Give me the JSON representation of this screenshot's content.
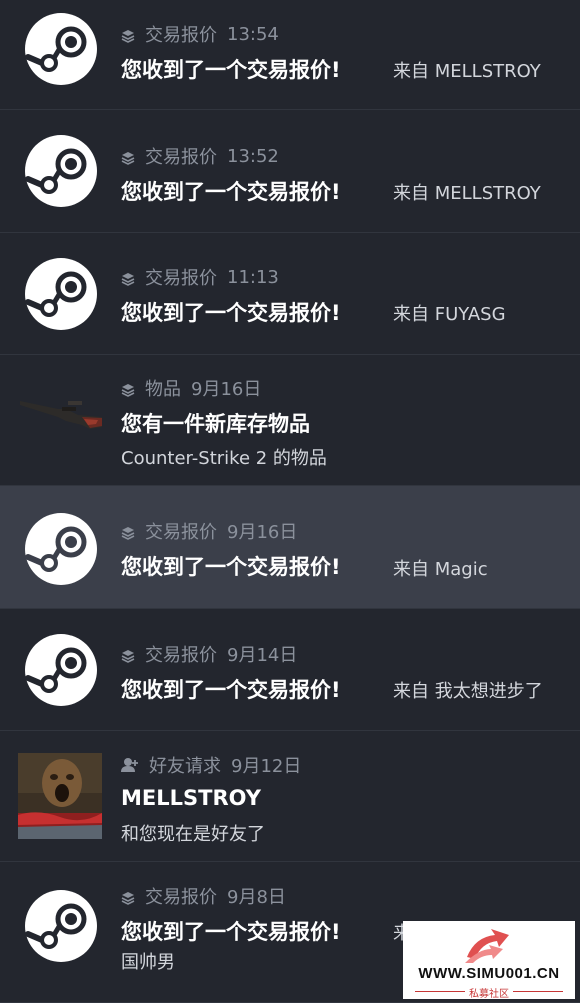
{
  "notifications": [
    {
      "type": "trade",
      "category": "交易报价",
      "time": "13:54",
      "title": "您收到了一个交易报价!",
      "from_prefix": "来自",
      "from_name": "MELLSTROY"
    },
    {
      "type": "trade",
      "category": "交易报价",
      "time": "13:52",
      "title": "您收到了一个交易报价!",
      "from_prefix": "来自",
      "from_name": "MELLSTROY"
    },
    {
      "type": "trade",
      "category": "交易报价",
      "time": "11:13",
      "title": "您收到了一个交易报价!",
      "from_prefix": "来自",
      "from_name": "FUYASG"
    },
    {
      "type": "item",
      "category": "物品",
      "time": "9月16日",
      "title": "您有一件新库存物品",
      "subtitle": "Counter-Strike 2 的物品"
    },
    {
      "type": "trade",
      "category": "交易报价",
      "time": "9月16日",
      "title": "您收到了一个交易报价!",
      "from_prefix": "来自",
      "from_name": "Magic",
      "highlighted": true
    },
    {
      "type": "trade",
      "category": "交易报价",
      "time": "9月14日",
      "title": "您收到了一个交易报价!",
      "from_prefix": "来自",
      "from_name": "我太想进步了"
    },
    {
      "type": "friend",
      "category": "好友请求",
      "time": "9月12日",
      "title": "MELLSTROY",
      "subtitle": "和您现在是好友了"
    },
    {
      "type": "trade",
      "category": "交易报价",
      "time": "9月8日",
      "title": "您收到了一个交易报价!",
      "from_prefix": "来",
      "subtitle": "国帅男"
    }
  ],
  "icons": {
    "steam": "steam-logo-icon",
    "layers": "layers-icon",
    "friend_add": "add-friend-icon"
  },
  "colors": {
    "background": "#23262e",
    "highlight": "#3b3f4a",
    "meta_text": "#8b919c"
  },
  "watermark": {
    "url": "WWW.SIMU001.CN",
    "tagline": "私募社区"
  }
}
